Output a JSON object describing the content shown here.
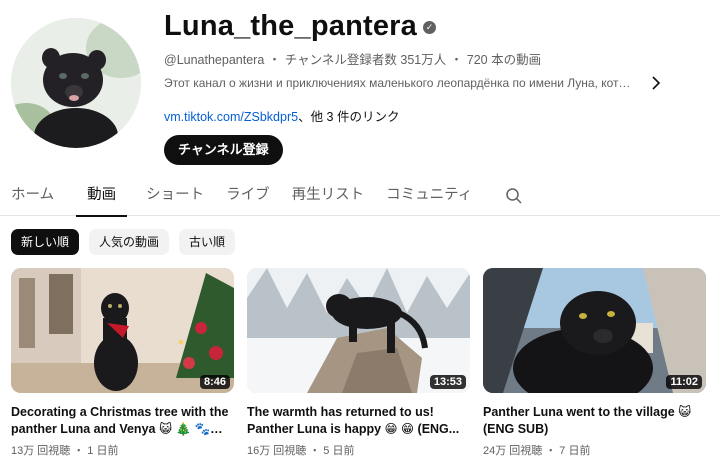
{
  "channel": {
    "name": "Luna_the_pantera",
    "verified_icon": "verified-check-icon",
    "handle": "@Lunathepantera",
    "subscribers": "チャンネル登録者数 351万人",
    "video_count": "720 本の動画",
    "separator": "・",
    "description": "Этот канал о жизни и приключениях маленького леопардёнка по имени Луна, котор...",
    "link_url": "vm.tiktok.com/ZSbkdpr5",
    "link_more": "、他 3 件のリンク",
    "subscribe_label": "チャンネル登録"
  },
  "tabs": [
    {
      "label": "ホーム",
      "active": false
    },
    {
      "label": "動画",
      "active": true
    },
    {
      "label": "ショート",
      "active": false
    },
    {
      "label": "ライブ",
      "active": false
    },
    {
      "label": "再生リスト",
      "active": false
    },
    {
      "label": "コミュニティ",
      "active": false
    }
  ],
  "chips": [
    {
      "label": "新しい順",
      "selected": true
    },
    {
      "label": "人気の動画",
      "selected": false
    },
    {
      "label": "古い順",
      "selected": false
    }
  ],
  "videos": [
    {
      "title": "Decorating a Christmas tree with the panther Luna and Venya 😺 🎄 🐾 (EN...",
      "duration": "8:46",
      "views": "13万 回視聴",
      "age": "1 日前"
    },
    {
      "title": "The warmth has returned to us! Panther Luna is happy 😁 😁 (ENG...",
      "duration": "13:53",
      "views": "16万 回視聴",
      "age": "5 日前"
    },
    {
      "title": "Panther Luna went to the village 😺 (ENG SUB)",
      "duration": "11:02",
      "views": "24万 回視聴",
      "age": "7 日前"
    }
  ],
  "meta_dot": "・",
  "colors": {
    "text_primary": "#0f0f0f",
    "text_secondary": "#606060",
    "link": "#065fd4",
    "chip_bg": "#f2f2f2"
  }
}
